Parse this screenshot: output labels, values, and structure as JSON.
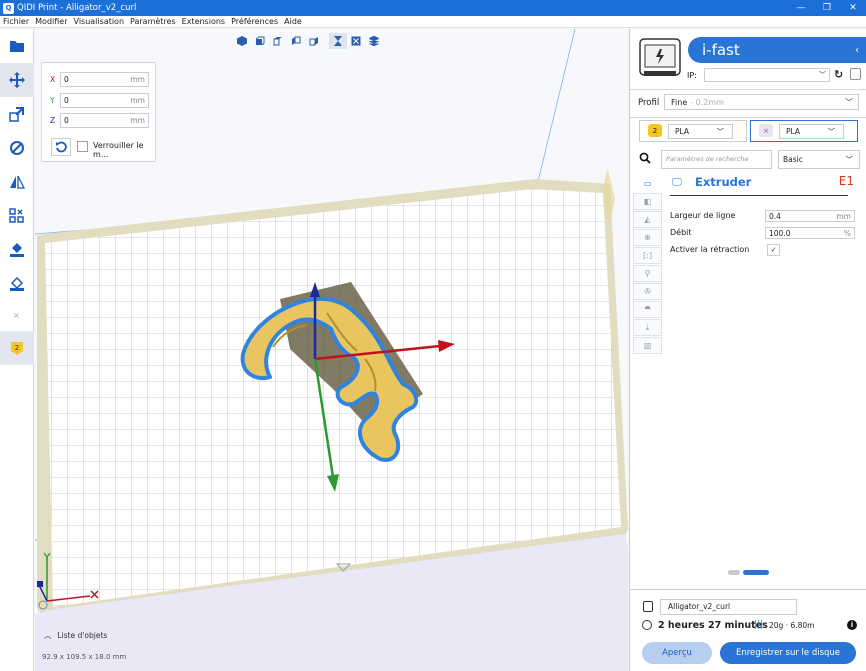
{
  "window": {
    "title": "QIDI Print - Alligator_v2_curl",
    "minimize": "—",
    "maximize": "❐",
    "close": "✕"
  },
  "menu": [
    "Fichier",
    "Modifier",
    "Visualisation",
    "Paramètres",
    "Extensions",
    "Préférences",
    "Aide"
  ],
  "move_panel": {
    "x_label": "X",
    "x_value": "0",
    "y_label": "Y",
    "y_value": "0",
    "z_label": "Z",
    "z_value": "0",
    "unit": "mm",
    "lock_label": "Verrouiller le m..."
  },
  "object_list": {
    "label": "Liste d'objets",
    "dimensions": "92.9 x 109.5 x 18.0 mm"
  },
  "printer": {
    "name": "i-fast",
    "ip_label": "IP:",
    "ip_value": ""
  },
  "profile": {
    "label": "Profil",
    "value": "Fine",
    "sub": "- 0.2mm"
  },
  "extruder_tabs": [
    {
      "badge": "2",
      "material": "PLA",
      "color": "#f3c623",
      "active": false
    },
    {
      "badge": "×",
      "material": "PLA",
      "color": "#e8e2f3",
      "active": true
    }
  ],
  "search": {
    "placeholder": "Paramètres de recherche",
    "mode": "Basic"
  },
  "section": {
    "title": "Extruder",
    "code": "E1"
  },
  "settings": [
    {
      "label": "Largeur de ligne",
      "value": "0.4",
      "unit": "mm"
    },
    {
      "label": "Débit",
      "value": "100.0",
      "unit": "%"
    },
    {
      "label": "Activer la rétraction",
      "value": "✓"
    }
  ],
  "output": {
    "file_name": "Alligator_v2_curl",
    "time": "2 heures 27 minutes",
    "material": "20g · 6.80m",
    "preview_label": "Aperçu",
    "save_label": "Enregistrer sur le disque"
  },
  "colors": {
    "accent": "#2a74d5",
    "model": "#e8c55e",
    "model_outline": "#2f84e0",
    "code": "#d9381e"
  }
}
